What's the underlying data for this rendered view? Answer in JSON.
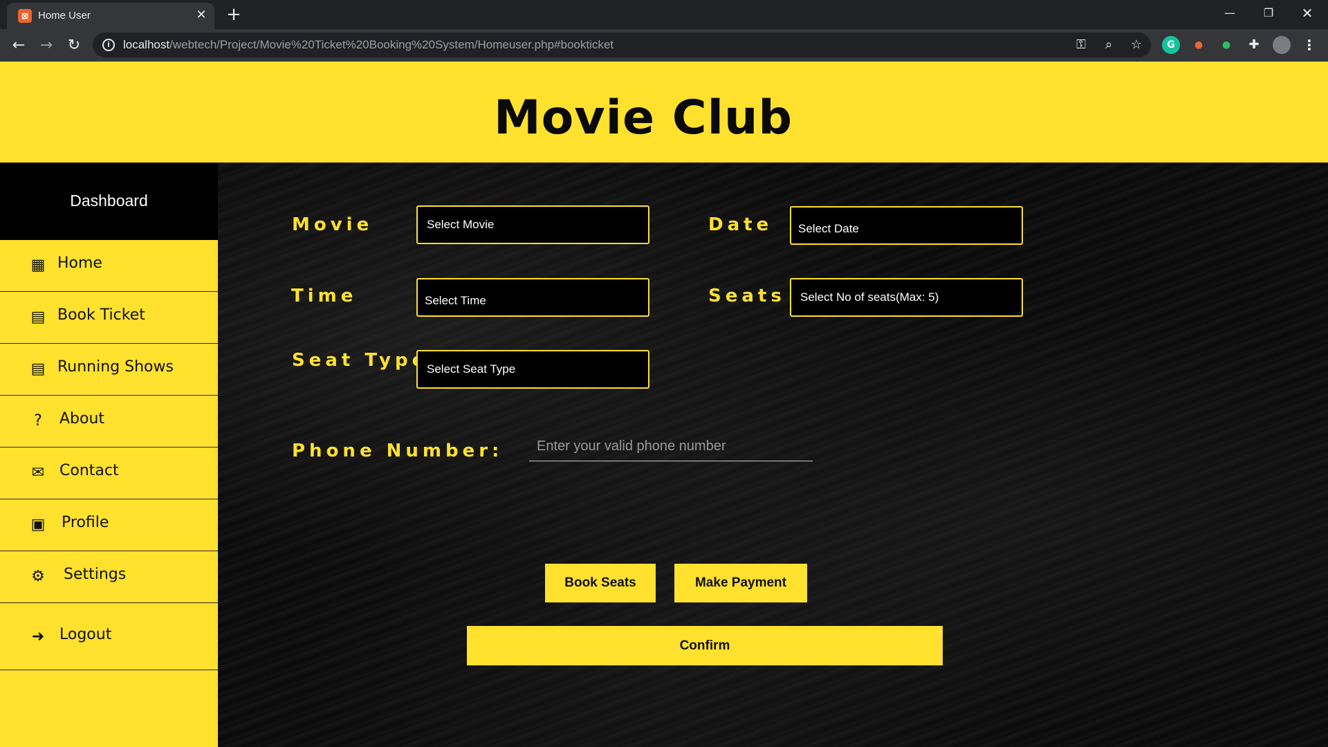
{
  "browser": {
    "tab_title": "Home User",
    "tab_favicon": "xampp-icon",
    "url_host": "localhost",
    "url_path": "/webtech/Project/Movie%20Ticket%20Booking%20System/Homeuser.php#bookticket",
    "icons": [
      "back-arrow-icon",
      "forward-arrow-icon",
      "reload-icon",
      "info-icon",
      "key-icon",
      "zoom-icon",
      "star-icon",
      "grammarly-icon",
      "extension-icon",
      "evernote-icon",
      "puzzle-icon",
      "profile-avatar-icon",
      "more-menu-icon"
    ]
  },
  "header": {
    "title": "Movie Club"
  },
  "sidebar": {
    "heading": "Dashboard",
    "items": [
      {
        "label": "Home",
        "icon": "grid-icon"
      },
      {
        "label": "Book Ticket",
        "icon": "calendar-icon"
      },
      {
        "label": "Running Shows",
        "icon": "calendar-icon"
      },
      {
        "label": "About",
        "icon": "question-circle-icon"
      },
      {
        "label": "Contact",
        "icon": "envelope-icon"
      },
      {
        "label": "Profile",
        "icon": "id-card-icon"
      },
      {
        "label": "Settings",
        "icon": "gears-icon"
      },
      {
        "label": "Logout",
        "icon": "sign-out-icon"
      }
    ]
  },
  "form": {
    "movie": {
      "label": "Movie",
      "value": "Select Movie"
    },
    "date": {
      "label": "Date",
      "value": "Select Date"
    },
    "time": {
      "label": "Time",
      "value": "Select Time"
    },
    "seats": {
      "label": "Seats",
      "value": "Select No of seats(Max: 5)"
    },
    "seat_type": {
      "label": "Seat Type",
      "value": "Select Seat Type"
    },
    "phone": {
      "label": "Phone Number:",
      "placeholder": "Enter your valid phone number",
      "value": ""
    }
  },
  "buttons": {
    "book_seats": "Book Seats",
    "make_payment": "Make Payment",
    "confirm": "Confirm"
  },
  "colors": {
    "accent": "#ffe12e",
    "background": "#000000",
    "text_dark": "#111111"
  }
}
